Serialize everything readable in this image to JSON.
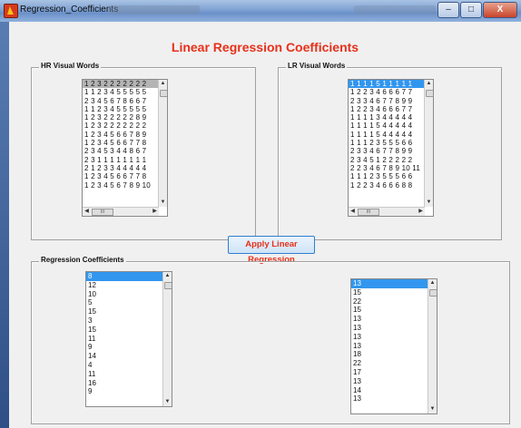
{
  "window": {
    "title": "Regression_Coefficients",
    "buttons": [
      "–",
      "□",
      "X"
    ]
  },
  "main_title": "Linear Regression Coefficients",
  "hr_panel": {
    "title": "HR Visual Words",
    "rows": [
      "1 2 3 2 2 2 2 2 2 2",
      "1 1 2 3 4 5 5 5 5 5",
      "2 3 4 5 6 7 8 6 6 7",
      "1 1 2 3 4 5 5 5 5 5",
      "1 2 3 2 2 2 2 2 8 9",
      "1 2 3 2 2 2 2 2 2 2",
      "1 2 3 4 5 6 6 7 8 9",
      "1 2 3 4 5 6 6 7 7 8",
      "2 3 4 5 3 4 4 8 6 7",
      "2 3 1 1 1 1 1 1 1 1",
      "2 1 2 3 3 4 4 4 4 4",
      "1 2 3 4 5 6 6 7 7 8",
      "1 2 3 4 5 6 7 8 9 10"
    ],
    "hscroll_label": "III"
  },
  "lr_panel": {
    "title": "LR Visual Words",
    "rows": [
      "1 1 1 1 5 1 1 1 1 1",
      "1 2 2 3 4 6 6 6 7 7",
      "2 3 3 4 6 7 7 8 9 9",
      "1 2 2 3 4 6 6 6 7 7",
      "1 1 1 1 3 4 4 4 4 4",
      "1 1 1 1 5 4 4 4 4 4",
      "1 1 1 1 5 4 4 4 4 4",
      "1 1 1 2 3 5 5 5 6 6",
      "2 3 3 4 6 7 7 8 9 9",
      "2 3 4 5 1 2 2 2 2 2",
      "2 2 3 4 6 7 8 9 10 11",
      "1 1 1 2 3 5 5 5 6 6",
      "1 2 2 3 4 6 6 6 8 8"
    ],
    "hscroll_label": "III"
  },
  "apply_button": "Apply Linear Regression",
  "regression_panel": {
    "title": "Regression Coefficients",
    "left_list": [
      "8",
      "12",
      "10",
      "5",
      "15",
      "3",
      "15",
      "11",
      "9",
      "14",
      "4",
      "11",
      "16",
      "9"
    ],
    "right_list": [
      "13",
      "15",
      "22",
      "15",
      "13",
      "13",
      "13",
      "13",
      "18",
      "22",
      "17",
      "13",
      "14",
      "13"
    ]
  },
  "colors": {
    "title_red": "#e8301a",
    "selection_blue": "#3296ee"
  }
}
